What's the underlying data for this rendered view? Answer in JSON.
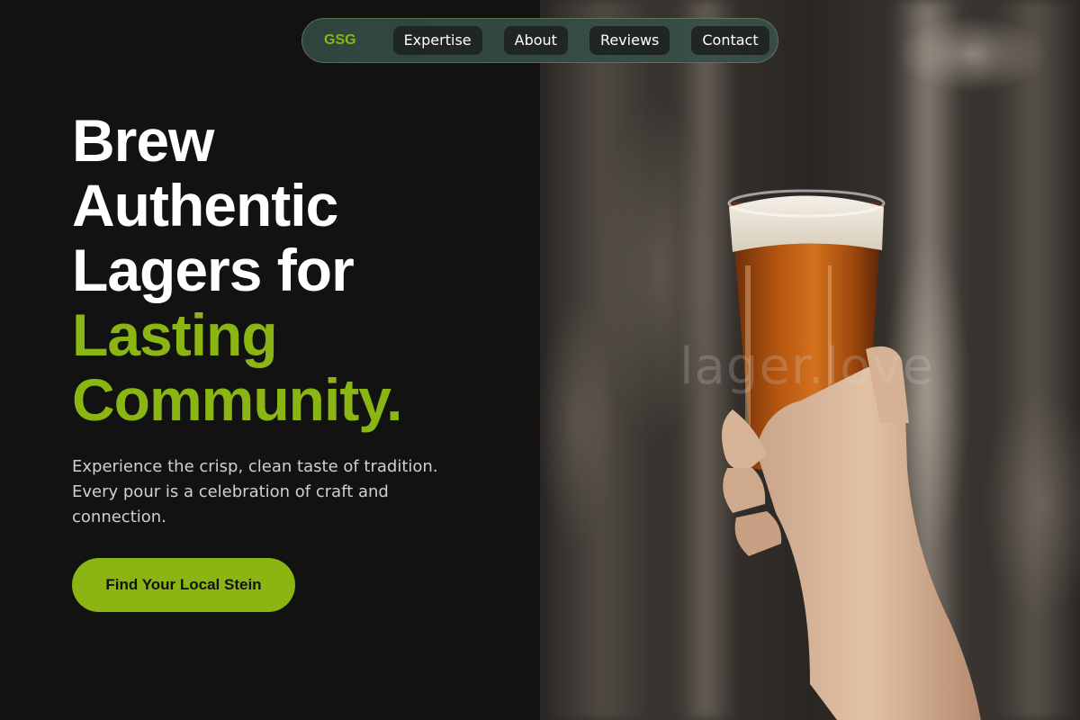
{
  "nav": {
    "logo": "GSG",
    "links": [
      {
        "label": "Expertise"
      },
      {
        "label": "About"
      },
      {
        "label": "Reviews"
      },
      {
        "label": "Contact"
      }
    ]
  },
  "hero": {
    "headline_lines": [
      "Brew",
      "Authentic",
      "Lagers for"
    ],
    "headline_accent_lines": [
      "Lasting",
      "Community."
    ],
    "subtext": "Experience the crisp, clean taste of tradition. Every pour is a celebration of craft and connection.",
    "cta_label": "Find Your Local Stein"
  },
  "photo": {
    "watermark": "lager.love",
    "subject": "hand raising a glass of amber lager in a brewery"
  },
  "colors": {
    "accent": "#8ab512",
    "background": "#121212",
    "text": "#ffffff",
    "muted_text": "#d0d0d0",
    "nav_background": "#33504a"
  }
}
